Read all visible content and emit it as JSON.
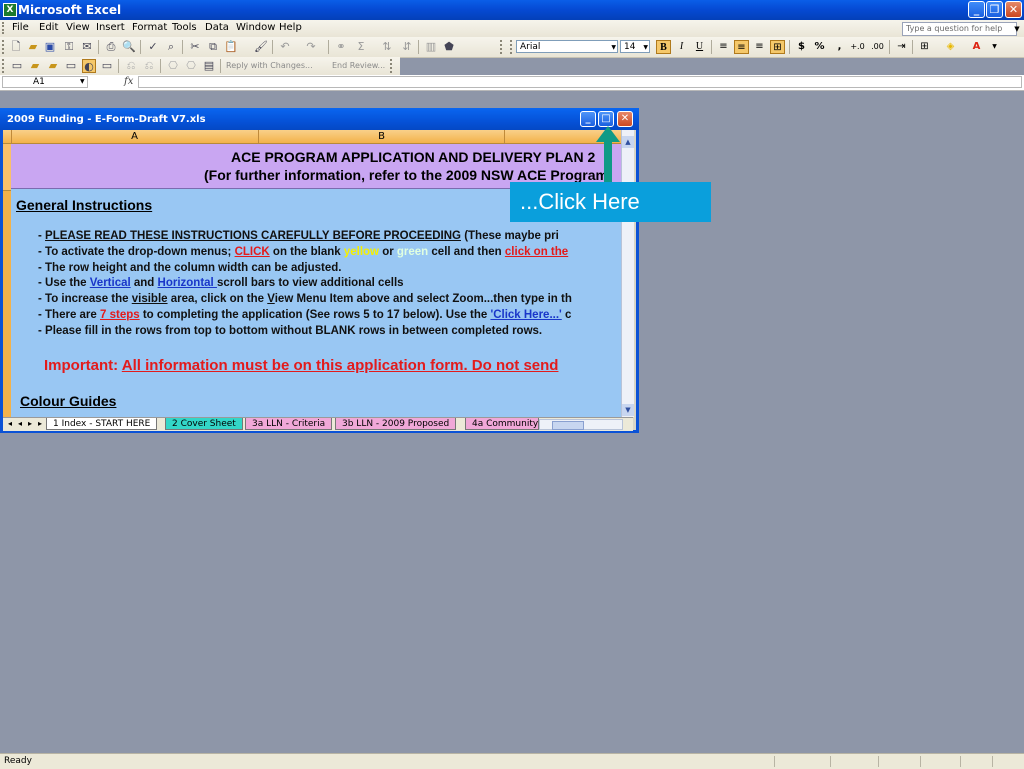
{
  "app": {
    "title": "Microsoft Excel",
    "help_placeholder": "Type a question for help"
  },
  "menu": [
    {
      "label": "File"
    },
    {
      "label": "Edit"
    },
    {
      "label": "View"
    },
    {
      "label": "Insert"
    },
    {
      "label": "Format"
    },
    {
      "label": "Tools"
    },
    {
      "label": "Data"
    },
    {
      "label": "Window"
    },
    {
      "label": "Help"
    }
  ],
  "toolbar": {
    "font_name": "Arial",
    "font_size": "14",
    "bold": "B",
    "italic": "I",
    "underline": "U",
    "currency": "$",
    "percent": "%",
    "comma": ",",
    "reply_with_changes": "Reply with Changes...",
    "end_review": "End Review..."
  },
  "formula_bar": {
    "name_box": "A1",
    "fx": "fx"
  },
  "workbook": {
    "title": "2009 Funding - E-Form-Draft V7.xls",
    "columns": [
      "A",
      "B"
    ],
    "banner_line1": "ACE PROGRAM APPLICATION AND DELIVERY PLAN 2",
    "banner_line2": "(For further information, refer to the 2009 NSW ACE Program",
    "general_heading": "General Instructions",
    "colour_heading": "Colour Guides",
    "inst1": {
      "prefix": "- ",
      "underlined": "PLEASE READ THESE INSTRUCTIONS CAREFULLY BEFORE PROCEEDING",
      "suffix": " (These maybe pri"
    },
    "inst2": {
      "a": "- To activate the drop-down menus; ",
      "click": "CLICK",
      "b": " on the blank ",
      "yellow": "yellow",
      "c": " or ",
      "green": "green",
      "d": " cell and then ",
      "click_on": "click on the"
    },
    "inst3": "- The row height and the column width can be adjusted.",
    "inst4": {
      "a": "- Use the ",
      "vertical": "Vertical",
      "b": " and ",
      "horizontal": "Horizontal ",
      "c": "scroll bars to view additional cells"
    },
    "inst5": {
      "a": "- To increase the ",
      "visible": "visible",
      "b": " area, click on the ",
      "view": "V",
      "c": "iew Menu Item above and select Zoom...then type in th"
    },
    "inst6": {
      "a": "- There are ",
      "steps": "7 steps",
      "b": " to completing the application (See rows 5 to 17 below).  Use the ",
      "click_here": "'Click Here...'",
      "c": " c"
    },
    "inst7": "- Please fill in the rows from top to bottom without BLANK rows in between completed rows.",
    "important_label": "Important: ",
    "important_text": "All information must be on this application form. Do not send",
    "tabs": [
      {
        "label": "1 Index - START HERE",
        "color": "#ffffff"
      },
      {
        "label": "2 Cover Sheet",
        "color": "#33d6c8"
      },
      {
        "label": "3a LLN - Criteria",
        "color": "#f0a8d8"
      },
      {
        "label": "3b LLN - 2009 Proposed",
        "color": "#f0a8d8"
      },
      {
        "label": "4a Community",
        "color": "#f0a8d8"
      }
    ]
  },
  "callout": {
    "text": "...Click Here",
    "color": "#0a9fdc",
    "arrow_color": "#0f9a86"
  },
  "status": {
    "text": "Ready"
  }
}
